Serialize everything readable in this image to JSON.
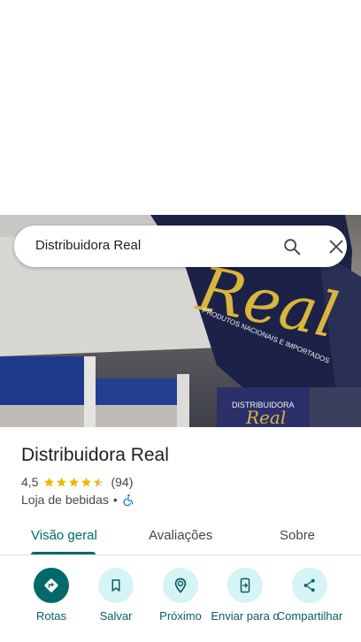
{
  "search": {
    "value": "Distribuidora Real"
  },
  "place": {
    "name": "Distribuidora Real",
    "rating": "4,5",
    "stars": 4.5,
    "review_count": "(94)",
    "category": "Loja de bebidas",
    "separator": "•"
  },
  "photo": {
    "sign_text": "Real",
    "sign_subtitle": "PRODUTOS NACIONAIS E IMPORTADOS",
    "sign_small_text": "DISTRIBUIDORA",
    "sign_small_real": "Real"
  },
  "tabs": [
    {
      "label": "Visão geral",
      "active": true
    },
    {
      "label": "Avaliações",
      "active": false
    },
    {
      "label": "Sobre",
      "active": false
    }
  ],
  "actions": [
    {
      "label": "Rotas",
      "icon": "directions-icon"
    },
    {
      "label": "Salvar",
      "icon": "bookmark-icon"
    },
    {
      "label": "Próximo",
      "icon": "nearby-icon"
    },
    {
      "label": "Enviar para o",
      "icon": "send-to-phone-icon"
    },
    {
      "label": "Compartilhar",
      "icon": "share-icon"
    }
  ],
  "colors": {
    "accent": "#006a6a",
    "action_bg": "#d6f3f5",
    "star": "#f4b400",
    "accessibility": "#1a73e8"
  }
}
